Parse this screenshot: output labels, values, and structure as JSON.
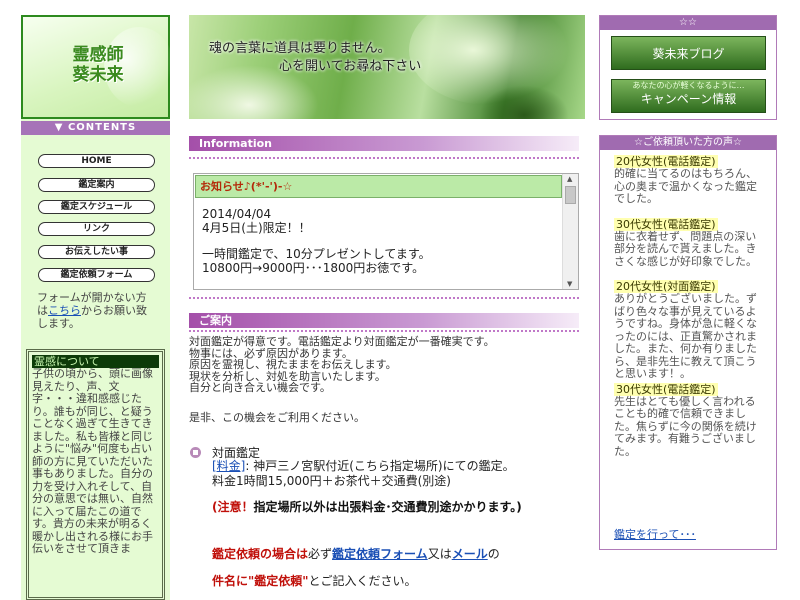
{
  "logo": {
    "line1": "霊感師",
    "line2": "葵未来"
  },
  "sidebar": {
    "contents_label": "▼ CONTENTS",
    "nav": [
      "HOME",
      "鑑定案内",
      "鑑定スケジュール",
      "リンク",
      "お伝えしたい事",
      "鑑定依頼フォーム"
    ],
    "form_note_before": "フォームが開かない方は",
    "form_note_link": "こちら",
    "form_note_after": "からお願い致します。",
    "spirit_title": "霊感について",
    "spirit_text": "子供の頃から、頭に画像見えたり、声、文字・・・違和感感じたり。誰もが同じ、と疑うことなく過ぎて生きてきました。私も皆様と同じように\"悩み\"何度も占い師の方に見ていただいた事もありました。自分の力を受け入れそして、自分の意思では無い、自然に入って届たこの道です。貴方の未来が明るく暖かし出される様にお手伝いをさせて頂きま"
  },
  "banner": {
    "line1": "魂の言葉に道具は要りません。",
    "line2": "心を開いてお尋ね下さい"
  },
  "info": {
    "bar_label": "Information",
    "news_title": "お知らせ♪(*'-')-☆",
    "news_date": "2014/04/04",
    "news_line2": "4月5日(土)限定！！",
    "news_line3": "一時間鑑定で、10分プレゼントしてます。",
    "news_line4": "10800円→9000円･･･1800円お徳です。"
  },
  "guide": {
    "bar_label": "ご案内",
    "text_lines": [
      "対面鑑定が得意です。電話鑑定より対面鑑定が一番確実です。",
      "物事には、必ず原因があります。",
      "原因を霊視し、視たままをお伝えします。",
      "現状を分析し、対処を助言いたします。",
      "自分と向き合えい機会です。"
    ],
    "note": "是非、この機会をご利用ください。",
    "service_title": "対面鑑定",
    "fee_tag": "[料金]",
    "fee_text": ": 神戸三ノ宮駅付近(こちら指定場所)にての鑑定。",
    "fee_line2": "料金1時間15,000円＋お茶代＋交通費(別途)",
    "warn_red": "(注意！",
    "warn_rest": "指定場所以外は出張料金･交通費別途かかります。)",
    "apply_red": "鑑定依頼の場合は",
    "apply_mid": "必ず",
    "apply_link1": "鑑定依頼フォーム",
    "apply_or": "又は",
    "apply_link2": "メール",
    "apply_end": "の",
    "apply2_red": "件名に\"鑑定依頼\"",
    "apply2_rest": "とご記入ください。"
  },
  "right": {
    "stars": "☆☆",
    "blog": "葵未来ブログ",
    "camp_small": "あなたの心が軽くなるように…",
    "camp": "キャンペーン情報",
    "voices_head": "☆ご依頼頂いた方の声☆",
    "voices": [
      {
        "title": "20代女性(電話鑑定)",
        "text": "的確に当てるのはもちろん、心の奥まで温かくなった鑑定でした。"
      },
      {
        "title": "30代女性(電話鑑定)",
        "text": "歯に衣着せず、問題点の深い部分を読んで貰えました。きさくな感じが好印象でした。"
      },
      {
        "title": "20代女性(対面鑑定)",
        "text": "ありがとうございました。ずばり色々な事が見えているようですね。身体が急に軽くなったのには、正直驚かされました。また、何か有りましたら、是非先生に教えて頂こうと思います！。"
      },
      {
        "title": "30代女性(電話鑑定)",
        "text": "先生はとても優しく言われることも的確で信頼できました。焦らずに今の関係を続けてみます。有難うございました。"
      }
    ],
    "voices_link": "鑑定を行って･･･"
  }
}
